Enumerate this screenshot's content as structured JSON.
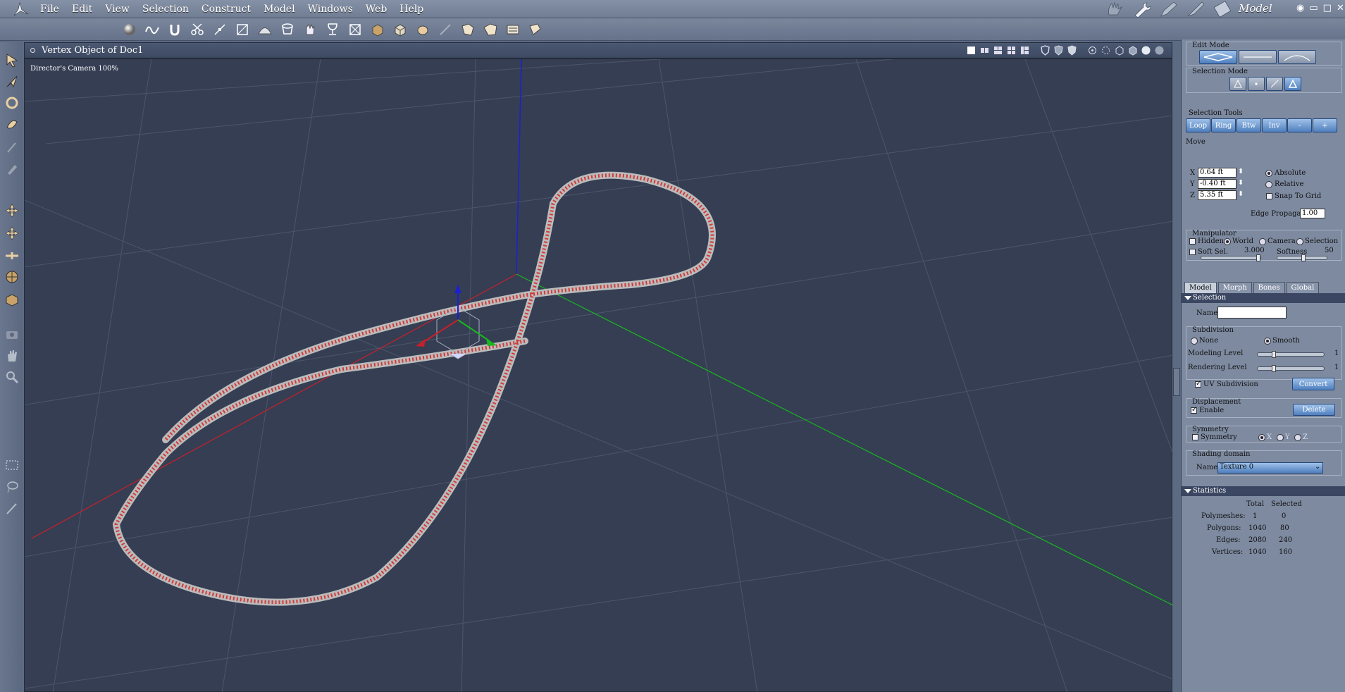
{
  "menu": {
    "items": [
      "File",
      "Edit",
      "View",
      "Selection",
      "Construct",
      "Model",
      "Windows",
      "Web",
      "Help"
    ],
    "room_title": "Model"
  },
  "viewport": {
    "title": "Vertex Object of Doc1",
    "camera_label": "Director's Camera 100%"
  },
  "panel": {
    "edit_mode_label": "Edit Mode",
    "selection_mode_label": "Selection Mode",
    "selection_tools_label": "Selection Tools",
    "selection_tools": [
      "Loop",
      "Ring",
      "Btw",
      "Inv",
      "-",
      "+"
    ],
    "move_label": "Move",
    "x_label": "X",
    "x_value": "0.64 ft",
    "y_label": "Y",
    "y_value": "-0.40 ft",
    "z_label": "Z",
    "z_value": "5.35 ft",
    "absolute": "Absolute",
    "relative": "Relative",
    "snap_to_grid": "Snap To Grid",
    "edge_propagation_label": "Edge Propagation",
    "edge_propagation_value": "1.00",
    "manipulator_label": "Manipulator",
    "hidden": "Hidden",
    "world": "World",
    "camera": "Camera",
    "selection": "Selection",
    "soft_sel": "Soft Sel.",
    "soft_sel_value": "3.000",
    "softness": "Softness",
    "softness_value": "50",
    "tabs": [
      "Model",
      "Morph",
      "Bones",
      "Global"
    ],
    "selection_bar": "Selection",
    "name_label": "Name",
    "name_value": "",
    "subdivision_label": "Subdivision",
    "none": "None",
    "smooth": "Smooth",
    "modeling_level": "Modeling Level",
    "modeling_level_value": "1",
    "rendering_level": "Rendering Level",
    "rendering_level_value": "1",
    "uv_subdivision": "UV Subdivision",
    "convert": "Convert",
    "displacement_label": "Displacement",
    "enable": "Enable",
    "delete": "Delete",
    "symmetry_label": "Symmetry",
    "symmetry": "Symmetry",
    "sym_x": "X",
    "sym_y": "Y",
    "sym_z": "Z",
    "shading_domain_label": "Shading domain",
    "shading_name_label": "Name",
    "shading_name_value": "Texture 0",
    "statistics_bar": "Statistics",
    "stats": {
      "headers": [
        "Total",
        "Selected"
      ],
      "rows": [
        {
          "label": "Polymeshes:",
          "total": "1",
          "selected": "0"
        },
        {
          "label": "Polygons:",
          "total": "1040",
          "selected": "80"
        },
        {
          "label": "Edges:",
          "total": "2080",
          "selected": "240"
        },
        {
          "label": "Vertices:",
          "total": "1040",
          "selected": "160"
        }
      ]
    }
  },
  "colors": {
    "accent_button": "#4f7fbf",
    "viewport_bg": "#353e53",
    "curve_color": "#d23a3a",
    "axis_x": "#c8202a",
    "axis_y": "#18b81e",
    "axis_z": "#1d1fd0"
  },
  "icons": {
    "toolbar": [
      "sphere-icon",
      "spline-icon",
      "magnet-icon",
      "scissors-icon",
      "vertex-icon",
      "extrude-icon",
      "dome-icon",
      "lathe-icon",
      "hand-shape-icon",
      "goblet-icon",
      "crossbox-icon",
      "box-icon",
      "package-icon",
      "torso-icon",
      "knife-icon",
      "shape-a-icon",
      "shape-b-icon",
      "shape-c-icon",
      "shape-d-icon"
    ],
    "left": [
      "select-arrow-icon",
      "direct-select-icon",
      "rotate-icon",
      "twist-icon",
      "pin-icon",
      "attach-icon",
      "move-icon",
      "scale-icon",
      "pan-icon",
      "sphere-rotate-icon",
      "box-face-icon",
      "camera-icon",
      "hand-icon",
      "zoom-icon",
      "marquee-icon",
      "lasso-icon",
      "brush-icon"
    ]
  }
}
